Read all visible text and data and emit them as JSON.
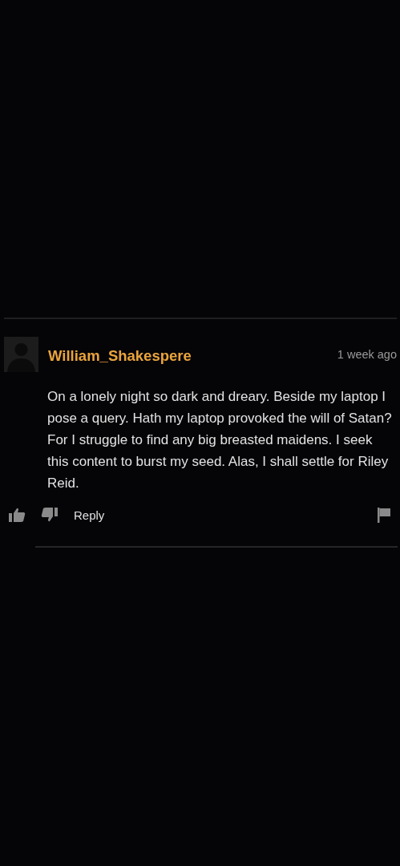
{
  "comment": {
    "author": "William_Shakespere",
    "time": "1 week ago",
    "text": "On a lonely night so dark and dreary. Beside my laptop I pose a query. Hath my laptop provoked the will of Satan? For I struggle to find any big breasted maidens. I seek this content to burst my seed. Alas, I shall settle for Riley Reid.",
    "actions": {
      "reply": "Reply"
    }
  }
}
